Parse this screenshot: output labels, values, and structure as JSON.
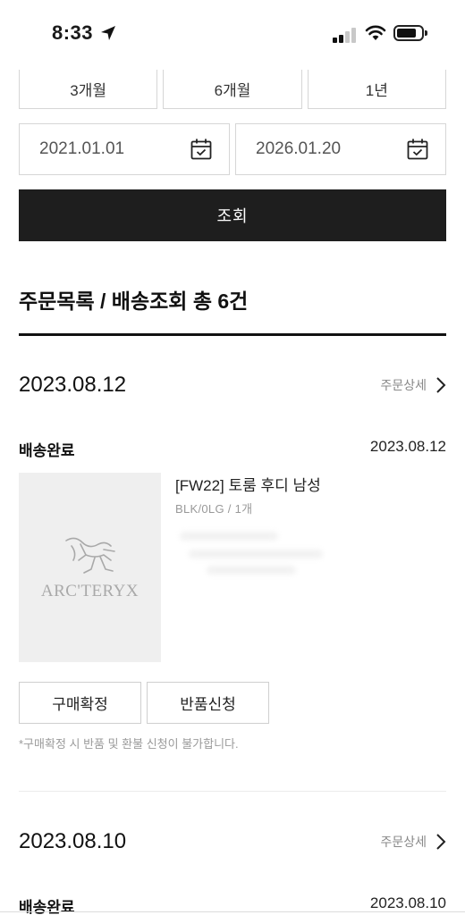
{
  "status_bar": {
    "time": "8:33"
  },
  "period_buttons": [
    {
      "label": "3개월"
    },
    {
      "label": "6개월"
    },
    {
      "label": "1년"
    }
  ],
  "date_range": {
    "start": "2021.01.01",
    "end": "2026.01.20"
  },
  "search_button": {
    "label": "조회"
  },
  "section": {
    "title": "주문목록 / 배송조회 총 6건"
  },
  "orders": [
    {
      "date": "2023.08.12",
      "detail_label": "주문상세",
      "status": "배송완료",
      "status_date": "2023.08.12",
      "product": {
        "brand_logo": "ARC'TERYX",
        "name": "[FW22] 토룸 후디 남성",
        "option": "BLK/0LG / 1개"
      },
      "actions": {
        "confirm": "구매확정",
        "return": "반품신청"
      },
      "notice": "*구매확정 시 반품 및 환불 신청이 불가합니다."
    },
    {
      "date": "2023.08.10",
      "detail_label": "주문상세",
      "status": "배송완료",
      "status_date": "2023.08.10"
    }
  ],
  "icons": {
    "calendar": "calendar-check-icon",
    "chevron": "chevron-right-icon",
    "location": "location-arrow-icon"
  }
}
